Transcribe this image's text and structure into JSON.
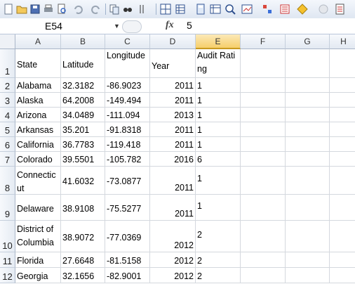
{
  "namebox": {
    "ref": "E54"
  },
  "formula": {
    "fx": "fx",
    "value": "5"
  },
  "columns": [
    "A",
    "B",
    "C",
    "D",
    "E",
    "F",
    "G",
    "H"
  ],
  "rows": [
    {
      "n": "1",
      "state": "State",
      "lat": "Latitude",
      "lon": "Longitude",
      "year": "Year",
      "rating": "Audit Rating"
    },
    {
      "n": "2",
      "state": "Alabama",
      "lat": "32.3182",
      "lon": "-86.9023",
      "year": "2011",
      "rating": "1"
    },
    {
      "n": "3",
      "state": "Alaska",
      "lat": "64.2008",
      "lon": "-149.494",
      "year": "2011",
      "rating": "1"
    },
    {
      "n": "4",
      "state": "Arizona",
      "lat": "34.0489",
      "lon": "-111.094",
      "year": "2013",
      "rating": "1"
    },
    {
      "n": "5",
      "state": "Arkansas",
      "lat": "35.201",
      "lon": "-91.8318",
      "year": "2011",
      "rating": "1"
    },
    {
      "n": "6",
      "state": "California",
      "lat": "36.7783",
      "lon": "-119.418",
      "year": "2011",
      "rating": "1"
    },
    {
      "n": "7",
      "state": "Colorado",
      "lat": "39.5501",
      "lon": "-105.782",
      "year": "2016",
      "rating": "6"
    },
    {
      "n": "8",
      "state": "Connecticut",
      "lat": "41.6032",
      "lon": "-73.0877",
      "year": "2011",
      "rating": "1"
    },
    {
      "n": "9",
      "state": "Delaware",
      "lat": "38.9108",
      "lon": "-75.5277",
      "year": "2011",
      "rating": "1"
    },
    {
      "n": "10",
      "state": "District of Columbia",
      "lat": "38.9072",
      "lon": "-77.0369",
      "year": "2012",
      "rating": "2"
    },
    {
      "n": "11",
      "state": "Florida",
      "lat": "27.6648",
      "lon": "-81.5158",
      "year": "2012",
      "rating": "2"
    },
    {
      "n": "12",
      "state": "Georgia",
      "lat": "32.1656",
      "lon": "-82.9001",
      "year": "2012",
      "rating": "2"
    }
  ]
}
